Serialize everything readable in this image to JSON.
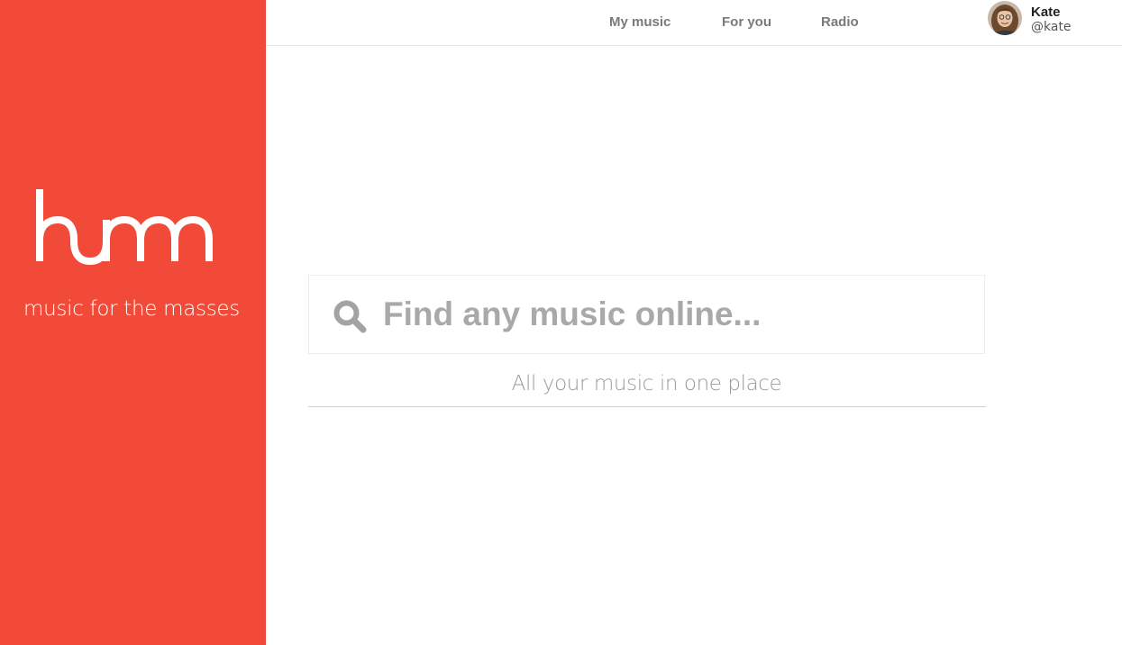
{
  "brand": {
    "logo_text": "humm",
    "tagline": "music for the masses",
    "color": "#f24a39"
  },
  "nav": {
    "items": [
      {
        "label": "My music"
      },
      {
        "label": "For you"
      },
      {
        "label": "Radio"
      }
    ]
  },
  "user": {
    "name": "Kate",
    "handle": "@kate"
  },
  "search": {
    "placeholder": "Find any music online...",
    "value": "",
    "icon": "search-icon"
  },
  "main": {
    "subtitle": "All your music in one place"
  }
}
